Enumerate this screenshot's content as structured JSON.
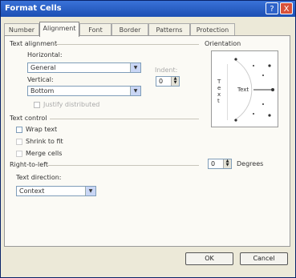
{
  "window": {
    "title": "Format Cells",
    "help_label": "?",
    "close_label": "X"
  },
  "tabs": [
    {
      "label": "Number"
    },
    {
      "label": "Alignment"
    },
    {
      "label": "Font"
    },
    {
      "label": "Border"
    },
    {
      "label": "Patterns"
    },
    {
      "label": "Protection"
    }
  ],
  "text_alignment": {
    "group_label": "Text alignment",
    "horizontal_label": "Horizontal:",
    "horizontal_value": "General",
    "indent_label": "Indent:",
    "indent_value": "0",
    "vertical_label": "Vertical:",
    "vertical_value": "Bottom",
    "justify_distributed_label": "Justify distributed"
  },
  "text_control": {
    "group_label": "Text control",
    "wrap_text": "Wrap text",
    "shrink_to_fit": "Shrink to fit",
    "merge_cells": "Merge cells"
  },
  "right_to_left": {
    "group_label": "Right-to-left",
    "direction_label": "Text direction:",
    "direction_value": "Context"
  },
  "orientation": {
    "group_label": "Orientation",
    "vertical_text": "Text",
    "text_label": "Text",
    "degrees_value": "0",
    "degrees_label": "Degrees"
  },
  "buttons": {
    "ok": "OK",
    "cancel": "Cancel"
  }
}
